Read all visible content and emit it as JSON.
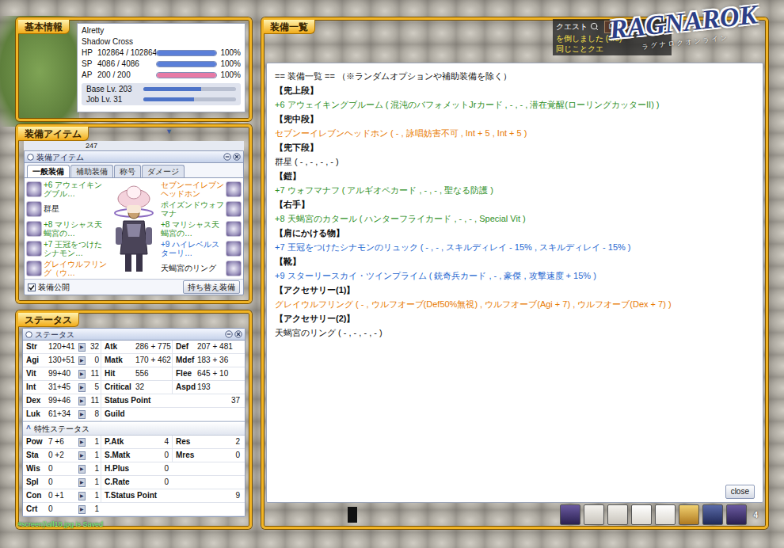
{
  "basic_info": {
    "title": "基本情報",
    "name": "Alretty",
    "job": "Shadow Cross",
    "bars": [
      {
        "label": "HP",
        "value": "102864 / 102864",
        "percent": "100%",
        "level": 1,
        "color": "#5b7fd8"
      },
      {
        "label": "SP",
        "value": "4086 / 4086",
        "percent": "100%",
        "level": 1,
        "color": "#5b7fd8"
      },
      {
        "label": "AP",
        "value": "200 / 200",
        "percent": "100%",
        "level": 1,
        "color": "#e77aa6"
      }
    ],
    "levels": [
      {
        "label": "Base Lv. 203",
        "level": 0.62
      },
      {
        "label": "Job Lv. 31",
        "level": 0.55
      }
    ]
  },
  "equip_items": {
    "title": "装備アイテム",
    "scroll": "▼",
    "count": "247",
    "window_title": "装備アイテム",
    "tabs": [
      {
        "label": "一般装備",
        "selected": true
      },
      {
        "label": "補助装備",
        "selected": false
      },
      {
        "label": "称号",
        "selected": false
      },
      {
        "label": "ダメージ",
        "selected": false
      }
    ],
    "left_slots": [
      {
        "text": "+6 アウェイキングブル…",
        "color": "#2f8f1f"
      },
      {
        "text": "群星",
        "color": "#111111"
      },
      {
        "text": "+8 マリシャス天蝎宮の…",
        "color": "#2f8f1f"
      },
      {
        "text": "+7 王冠をつけたシナモン…",
        "color": "#2f8f1f"
      },
      {
        "text": "グレイウルフリング（ウ…",
        "color": "#e87a00"
      }
    ],
    "right_slots": [
      {
        "text": "セブンーイレブンヘッドホン",
        "color": "#e87a00"
      },
      {
        "text": "ポイズンドウォフマナ",
        "color": "#2f8f1f"
      },
      {
        "text": "+8 マリシャス天蝎宮の…",
        "color": "#2f8f1f"
      },
      {
        "text": "+9 ハイレベルスターリ…",
        "color": "#2466d0"
      },
      {
        "text": "天蝎宮のリング",
        "color": "#111111"
      }
    ],
    "checkbox": {
      "label": "装備公開",
      "checked": true
    },
    "button": "持ち替え装備"
  },
  "status": {
    "title": "ステータス",
    "window_title": "ステータス",
    "increase_glyph": "▶",
    "stats": [
      {
        "name": "Str",
        "value": "120+41",
        "cost": "32",
        "pairs": [
          {
            "label": "Atk",
            "value": "286 + 775"
          },
          {
            "label": "Def",
            "value": "207 + 481"
          }
        ]
      },
      {
        "name": "Agi",
        "value": "130+51",
        "cost": "0",
        "pairs": [
          {
            "label": "Matk",
            "value": "170 + 462"
          },
          {
            "label": "Mdef",
            "value": "183 + 36"
          }
        ]
      },
      {
        "name": "Vit",
        "value": "99+40",
        "cost": "11",
        "pairs": [
          {
            "label": "Hit",
            "value": "556"
          },
          {
            "label": "Flee",
            "value": "645 + 10"
          }
        ]
      },
      {
        "name": "Int",
        "value": "31+45",
        "cost": "5",
        "pairs": [
          {
            "label": "Critical",
            "value": "32"
          },
          {
            "label": "Aspd",
            "value": "193"
          }
        ]
      },
      {
        "name": "Dex",
        "value": "99+46",
        "cost": "11",
        "pairs": [
          {
            "label": "Status Point",
            "value": "37",
            "wide": true
          }
        ]
      },
      {
        "name": "Luk",
        "value": "61+34",
        "cost": "8",
        "pairs": [
          {
            "label": "Guild",
            "wide": true
          }
        ]
      }
    ],
    "trait_section": {
      "toggle": "^",
      "label": "特性ステータス"
    },
    "traits": [
      {
        "name": "Pow",
        "value": "7 +6",
        "cost": "1",
        "pairs": [
          {
            "label": "P.Atk",
            "value": "4"
          },
          {
            "label": "Res",
            "value": "2"
          }
        ]
      },
      {
        "name": "Sta",
        "value": "0 +2",
        "cost": "1",
        "pairs": [
          {
            "label": "S.Matk",
            "value": "0"
          },
          {
            "label": "Mres",
            "value": "0"
          }
        ]
      },
      {
        "name": "Wis",
        "value": "0",
        "cost": "1",
        "pairs": [
          {
            "label": "H.Plus",
            "value": "0"
          }
        ]
      },
      {
        "name": "Spl",
        "value": "0",
        "cost": "1",
        "pairs": [
          {
            "label": "C.Rate",
            "value": "0"
          }
        ]
      },
      {
        "name": "Con",
        "value": "0 +1",
        "cost": "1",
        "pairs": [
          {
            "label": "T.Status Point",
            "value": "9",
            "wide": true
          }
        ]
      },
      {
        "name": "Crt",
        "value": "0",
        "cost": "1",
        "pairs": []
      }
    ]
  },
  "equipment_list": {
    "title": "装備一覧",
    "heading": "== 装備一覧 == （※ランダムオプションや補助装備を除く）",
    "sections": [
      {
        "slot": "【兜上段】",
        "item": "+6 アウェイキングブルーム ( 混沌のバフォメットJrカード , - , - , 潜在覚醒(ローリングカッターII) )",
        "color": "#2f8f1f"
      },
      {
        "slot": "【兜中段】",
        "item": "セブンーイレブンヘッドホン ( - , 詠唱妨害不可 , Int + 5 , Int + 5 )",
        "color": "#e87a00"
      },
      {
        "slot": "【兜下段】",
        "item": "群星 ( - , - , - , - )",
        "color": "#111111"
      },
      {
        "slot": "【鎧】",
        "item": "+7 ウォフマナフ ( アルギオペカード , - , - , 聖なる防護 )",
        "color": "#2f8f1f"
      },
      {
        "slot": "【右手】",
        "item": "+8 天蝎宮のカタール ( ハンターフライカード , - , - , Special Vit )",
        "color": "#2f8f1f"
      },
      {
        "slot": "【肩にかける物】",
        "item": "+7 王冠をつけたシナモンのリュック ( - , - , スキルディレイ - 15% , スキルディレイ - 15% )",
        "color": "#2466d0"
      },
      {
        "slot": "【靴】",
        "item": "+9 スターリースカイ・ツインプライム ( 銃奇兵カード , - , 豪傑 , 攻撃速度 + 15% )",
        "color": "#2466d0"
      },
      {
        "slot": "【アクセサリー(1)】",
        "item": "グレイウルフリング ( - , ウルフオーブ(Def50%無視) , ウルフオーブ(Agi + 7) , ウルフオーブ(Dex + 7) )",
        "color": "#e87a00"
      },
      {
        "slot": "【アクセサリー(2)】",
        "item": "天蝎宮のリング ( - , - , - , - )",
        "color": "#111111"
      }
    ],
    "close": "close"
  },
  "quest": {
    "title": "クエスト",
    "button": "レベル",
    "lines": [
      "を倒しました (4/5)",
      "同じことクエ"
    ]
  },
  "logo": {
    "text": "RAGNAROK",
    "subtitle": "ラグナロクオンライン"
  },
  "hotbar": {
    "count": "4"
  },
  "chat_line": "#screen)\\all18.jpg is Saved"
}
